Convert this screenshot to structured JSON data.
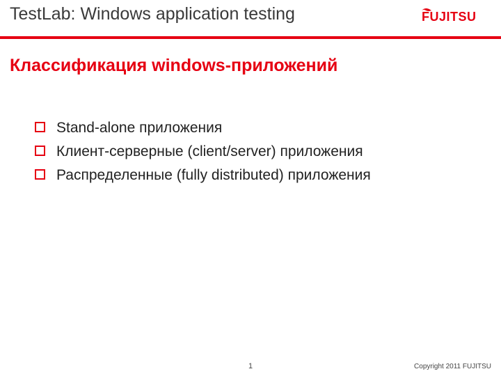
{
  "header": {
    "title": "TestLab: Windows application testing",
    "logo_label": "FUJITSU"
  },
  "slide": {
    "title": "Классификация windows-приложений"
  },
  "bullets": [
    "Stand-alone приложения",
    "Клиент-серверные (client/server) приложения",
    "Распределенные (fully distributed) приложения"
  ],
  "footer": {
    "page": "1",
    "copyright": "Copyright 2011 FUJITSU"
  }
}
